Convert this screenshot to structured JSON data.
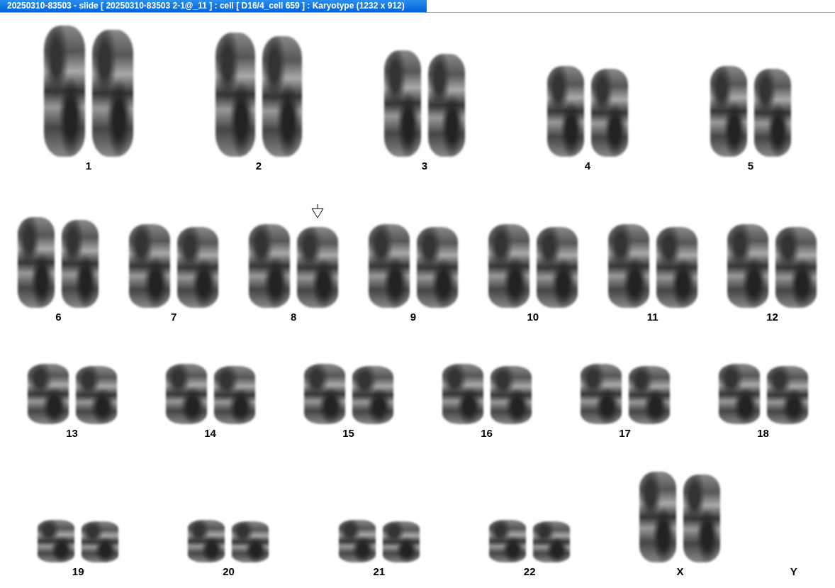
{
  "window": {
    "title": "20250310-83503 - slide [ 20250310-83503 2-1@_11 ] : cell [ D16/4_cell 659 ] : Karyotype  (1232 x 912)"
  },
  "rows": [
    {
      "items": [
        {
          "label": "1",
          "kind": "pair",
          "marked": false
        },
        {
          "label": "2",
          "kind": "pair",
          "marked": false
        },
        {
          "label": "3",
          "kind": "pair",
          "marked": false
        },
        {
          "label": "4",
          "kind": "pair",
          "marked": false
        },
        {
          "label": "5",
          "kind": "pair",
          "marked": false
        }
      ]
    },
    {
      "items": [
        {
          "label": "6",
          "kind": "pair",
          "marked": false
        },
        {
          "label": "7",
          "kind": "pair",
          "marked": false
        },
        {
          "label": "8",
          "kind": "pair",
          "marked": true
        },
        {
          "label": "9",
          "kind": "pair",
          "marked": false
        },
        {
          "label": "10",
          "kind": "pair",
          "marked": false
        },
        {
          "label": "11",
          "kind": "pair",
          "marked": false
        },
        {
          "label": "12",
          "kind": "pair",
          "marked": false
        }
      ]
    },
    {
      "items": [
        {
          "label": "13",
          "kind": "pair",
          "marked": false
        },
        {
          "label": "14",
          "kind": "pair",
          "marked": false
        },
        {
          "label": "15",
          "kind": "pair",
          "marked": false
        },
        {
          "label": "16",
          "kind": "pair",
          "marked": false
        },
        {
          "label": "17",
          "kind": "pair",
          "marked": false
        },
        {
          "label": "18",
          "kind": "pair",
          "marked": false
        }
      ]
    },
    {
      "items": [
        {
          "label": "19",
          "kind": "pair",
          "marked": false
        },
        {
          "label": "20",
          "kind": "pair",
          "marked": false
        },
        {
          "label": "21",
          "kind": "pair",
          "marked": false
        },
        {
          "label": "22",
          "kind": "pair",
          "marked": false
        },
        {
          "label": "X",
          "kind": "pair",
          "marked": false
        },
        {
          "label": "Y",
          "kind": "empty",
          "marked": false
        }
      ]
    }
  ]
}
